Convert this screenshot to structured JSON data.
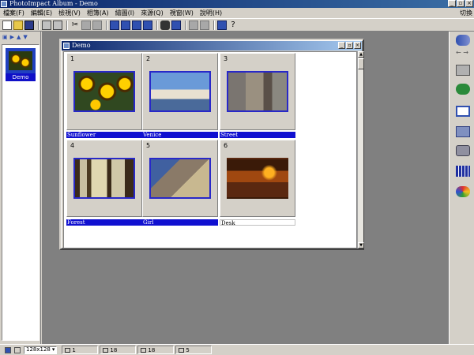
{
  "window": {
    "title": "PhotoImpact Album - Demo"
  },
  "menu": {
    "items": [
      "檔案(F)",
      "編輯(E)",
      "檢視(V)",
      "相簿(A)",
      "繪圖(I)",
      "來源(Q)",
      "視窗(W)",
      "說明(H)"
    ],
    "right_label": "切換"
  },
  "album_list": {
    "items": [
      {
        "label": "Demo"
      }
    ]
  },
  "child_window": {
    "title": "Demo",
    "cells": [
      {
        "number": "1",
        "caption": "Sunflower",
        "selected": true
      },
      {
        "number": "2",
        "caption": "Venice",
        "selected": true
      },
      {
        "number": "3",
        "caption": "Street",
        "selected": true
      },
      {
        "number": "4",
        "caption": "Forest",
        "selected": true
      },
      {
        "number": "5",
        "caption": "Girl",
        "selected": true
      },
      {
        "number": "6",
        "caption": "Desk",
        "selected": false
      }
    ]
  },
  "statusbar": {
    "thumb_size": "128x128",
    "cells": [
      "1",
      "18",
      "18",
      "5"
    ]
  }
}
